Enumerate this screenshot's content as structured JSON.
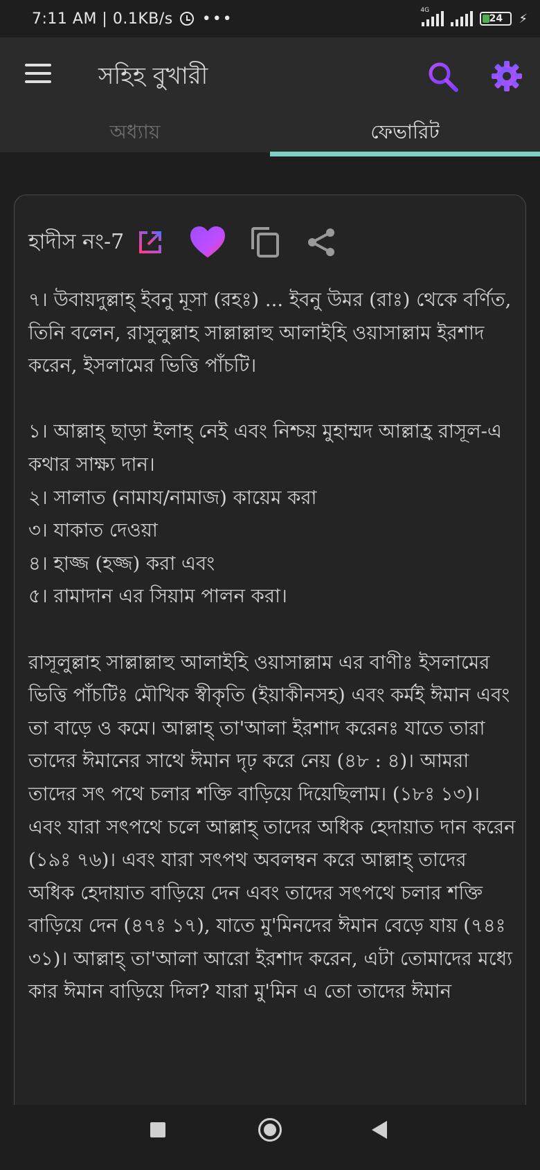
{
  "status": {
    "time": "7:11 AM | 0.1KB/s",
    "dots": "•••",
    "net_tag": "4G",
    "battery": "24",
    "charging_icon": "bolt-icon"
  },
  "appbar": {
    "title": "সহিহ বুখারী",
    "search_icon": "search-icon",
    "settings_icon": "gear-icon",
    "accent_color": "#9c4dff"
  },
  "tabs": [
    {
      "label": "অধ্যায়",
      "active": false
    },
    {
      "label": "ফেভারিট",
      "active": true
    }
  ],
  "tab_indicator_color": "#7fd1c7",
  "card": {
    "label": "হাদীস নং-7",
    "icons": [
      "open-external-icon",
      "heart-icon",
      "copy-icon",
      "share-icon"
    ],
    "paragraphs": [
      "৭। উবায়দুল্লাহ্ ইবনু মূসা (রহঃ) ... ইবনু উমর (রাঃ) থেকে বর্ণিত, তিনি বলেন, রাসুলুল্লাহ সাল্লাল্লাহু আলাইহি ওয়াসাল্লাম ইরশাদ করেন, ইসলামের ভিত্তি পাঁচটি।",
      "",
      "১। আল্লাহ্ ছাড়া ইলাহ্ নেই এবং নিশ্চয় মুহাম্মদ আল্লাহ্র রাসূল-এ কথার সাক্ষ্য দান।",
      "২। সালাত (নামায/নামাজ) কায়েম করা",
      "৩। যাকাত দেওয়া",
      "৪। হাজ্জ (হজ্জ) করা এবং",
      "৫। রামাদান এর সিয়াম পালন করা।",
      "",
      "রাসূলুল্লাহ সাল্লাল্লাহু আলাইহি ওয়াসাল্লাম এর বাণীঃ ইসলামের ভিত্তি পাঁচটিঃ মৌখিক স্বীকৃতি (ইয়াকীনসহ) এবং কর্মই ঈমান এবং তা বাড়ে ও কমে। আল্লাহ্ তা'আলা ইরশাদ করেনঃ যাতে তারা তাদের ঈমানের সাথে ঈমান দৃঢ় করে নেয় (৪৮ : ৪)। আমরা তাদের সৎ পথে চলার শক্তি বাড়িয়ে দিয়েছিলাম। (১৮ঃ ১৩)। এবং যারা সৎপথে চলে আল্লাহ্ তাদের অধিক হেদায়াত দান করেন (১৯ঃ ৭৬)। এবং যারা সৎপথ অবলম্বন করে আল্লাহ্ তাদের অধিক হেদায়াত বাড়িয়ে দেন এবং তাদের সৎপথে চলার শক্তি বাড়িয়ে দেন (৪৭ঃ ১৭), যাতে মু'মিনদের ঈমান বেড়ে যায় (৭৪ঃ ৩১)। আল্লাহ্ তা'আলা আরো ইরশাদ করেন, এটা তোমাদের মধ্যে কার ঈমান বাড়িয়ে দিল? যারা মু'মিন এ তো তাদের ঈমান"
    ]
  },
  "navbar": {
    "icons": [
      "recents-square-icon",
      "home-circle-icon",
      "back-triangle-icon"
    ]
  }
}
